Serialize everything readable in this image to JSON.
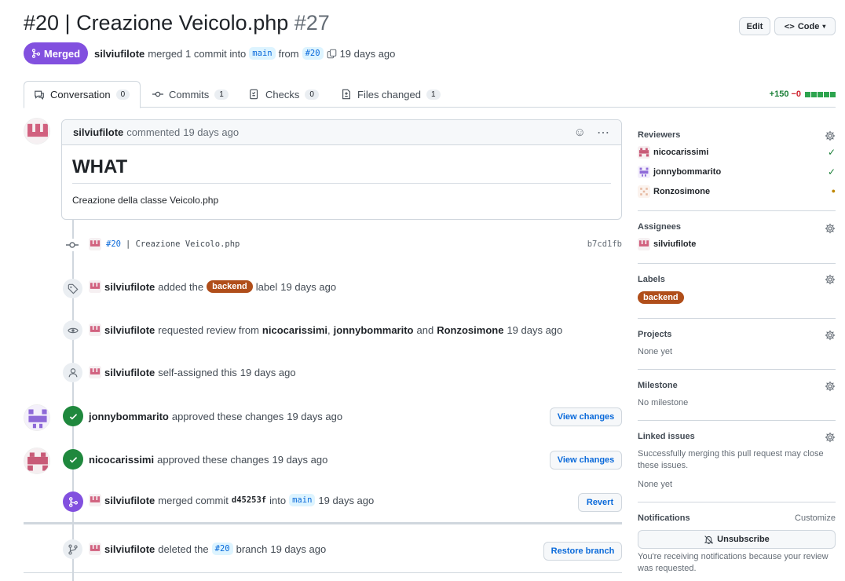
{
  "header": {
    "title": "#20 | Creazione Veicolo.php",
    "number": "#27",
    "edit_label": "Edit",
    "code_label": "Code",
    "state": "Merged",
    "author": "silviufilote",
    "merged_text": "merged 1 commit into",
    "base_branch": "main",
    "from_text": "from",
    "head_branch": "#20",
    "time": "19 days ago"
  },
  "tabs": [
    {
      "label": "Conversation",
      "count": "0"
    },
    {
      "label": "Commits",
      "count": "1"
    },
    {
      "label": "Checks",
      "count": "0"
    },
    {
      "label": "Files changed",
      "count": "1"
    }
  ],
  "diffstat": {
    "added": "+150",
    "removed": "−0",
    "color_add": "#1a7f37"
  },
  "comment": {
    "author": "silviufilote",
    "action": "commented",
    "time": "19 days ago",
    "heading": "WHAT",
    "body": "Creazione della classe Veicolo.php"
  },
  "timeline": {
    "commit": {
      "branch": "#20",
      "message": "| Creazione Veicolo.php",
      "sha": "b7cd1fb"
    },
    "label_event": {
      "author": "silviufilote",
      "pre": "added the",
      "label": "backend",
      "post": "label",
      "time": "19 days ago"
    },
    "review_request": {
      "author": "silviufilote",
      "pre": "requested review from",
      "r1": "nicocarissimi",
      "sep": ",",
      "r2": "jonnybommarito",
      "and": "and",
      "r3": "Ronzosimone",
      "time": "19 days ago"
    },
    "self_assign": {
      "author": "silviufilote",
      "text": "self-assigned this",
      "time": "19 days ago"
    },
    "approval1": {
      "author": "jonnybommarito",
      "text": "approved these changes",
      "time": "19 days ago",
      "button": "View changes"
    },
    "approval2": {
      "author": "nicocarissimi",
      "text": "approved these changes",
      "time": "19 days ago",
      "button": "View changes"
    },
    "merge": {
      "author": "silviufilote",
      "text": "merged commit",
      "sha": "d45253f",
      "into": "into",
      "branch": "main",
      "time": "19 days ago",
      "button": "Revert"
    },
    "delete": {
      "author": "silviufilote",
      "text": "deleted the",
      "branch": "#20",
      "post": "branch",
      "time": "19 days ago",
      "button": "Restore branch"
    }
  },
  "sidebar": {
    "reviewers_title": "Reviewers",
    "reviewers": [
      {
        "name": "nicocarissimi",
        "status": "✓"
      },
      {
        "name": "jonnybommarito",
        "status": "✓"
      },
      {
        "name": "Ronzosimone",
        "status": "●"
      }
    ],
    "assignees_title": "Assignees",
    "assignee": "silviufilote",
    "labels_title": "Labels",
    "label": "backend",
    "projects_title": "Projects",
    "projects_value": "None yet",
    "milestone_title": "Milestone",
    "milestone_value": "No milestone",
    "linked_title": "Linked issues",
    "linked_desc_1": "Successfully merging this pull request may close",
    "linked_desc_2": "these issues.",
    "linked_value": "None yet",
    "notifications_title": "Notifications",
    "customize": "Customize",
    "unsubscribe": "Unsubscribe",
    "notif_desc_1": "You're receiving notifications because your review",
    "notif_desc_2": "was requested."
  }
}
